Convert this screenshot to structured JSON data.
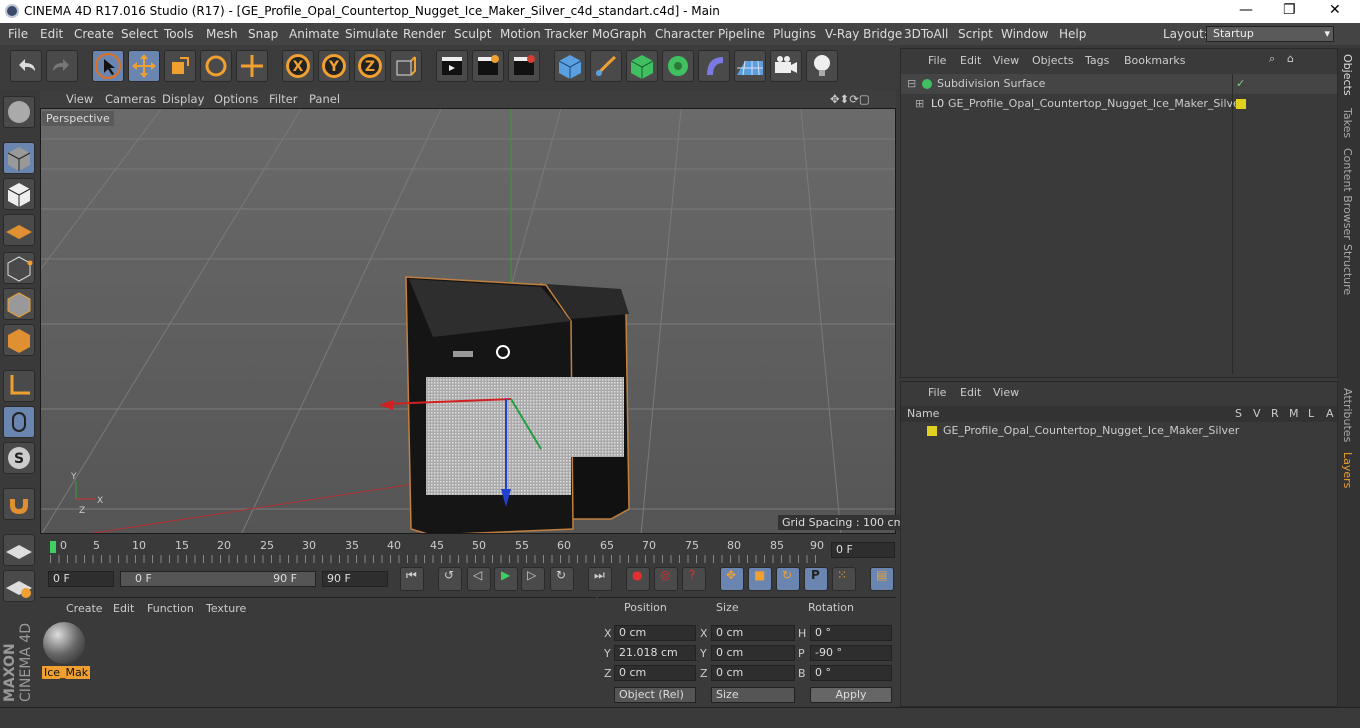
{
  "window": {
    "title": "CINEMA 4D R17.016 Studio (R17) - [GE_Profile_Opal_Countertop_Nugget_Ice_Maker_Silver_c4d_standart.c4d] - Main",
    "minimize": "—",
    "maximize": "❐",
    "close": "✕"
  },
  "menu": [
    "File",
    "Edit",
    "Create",
    "Select",
    "Tools",
    "Mesh",
    "Snap",
    "Animate",
    "Simulate",
    "Render",
    "Sculpt",
    "Motion Tracker",
    "MoGraph",
    "Character",
    "Pipeline",
    "Plugins",
    "V-Ray Bridge",
    "3DToAll",
    "Script",
    "Window",
    "Help"
  ],
  "layout": {
    "label": "Layout:",
    "value": "Startup"
  },
  "viewport": {
    "menu": [
      "View",
      "Cameras",
      "Display",
      "Options",
      "Filter",
      "Panel"
    ],
    "label": "Perspective",
    "grid_spacing": "Grid Spacing : 100 cm"
  },
  "timeline": {
    "ticks": [
      "0",
      "5",
      "10",
      "15",
      "20",
      "25",
      "30",
      "35",
      "40",
      "45",
      "50",
      "55",
      "60",
      "65",
      "70",
      "75",
      "80",
      "85",
      "90"
    ],
    "current_frame": "0 F",
    "start": "0 F",
    "range_start": "0 F",
    "range_end": "90 F",
    "end": "90 F"
  },
  "material": {
    "menu": [
      "Create",
      "Edit",
      "Function",
      "Texture"
    ],
    "name": "Ice_Mak"
  },
  "coords": {
    "headers": [
      "Position",
      "Size",
      "Rotation"
    ],
    "px": "0 cm",
    "py": "21.018 cm",
    "pz": "0 cm",
    "sx": "0 cm",
    "sy": "0 cm",
    "sz": "0 cm",
    "rh": "0 °",
    "rp": "-90 °",
    "rb": "0 °",
    "mode": "Object (Rel)",
    "size_mode": "Size",
    "apply": "Apply"
  },
  "objects": {
    "menu": [
      "File",
      "Edit",
      "View",
      "Objects",
      "Tags",
      "Bookmarks"
    ],
    "items": [
      "Subdivision Surface",
      "GE_Profile_Opal_Countertop_Nugget_Ice_Maker_Silver"
    ]
  },
  "layers": {
    "menu": [
      "File",
      "Edit",
      "View"
    ],
    "header": "Name",
    "cols": [
      "S",
      "V",
      "R",
      "M",
      "L",
      "A"
    ],
    "item": "GE_Profile_Opal_Countertop_Nugget_Ice_Maker_Silver"
  },
  "right_tabs": [
    "Objects",
    "Takes",
    "Content Browser",
    "Structure",
    "Attributes",
    "Layers"
  ],
  "brand": [
    "MAXON",
    "CINEMA 4D"
  ],
  "axis": {
    "x": "X",
    "y": "Y",
    "z": "Z"
  }
}
